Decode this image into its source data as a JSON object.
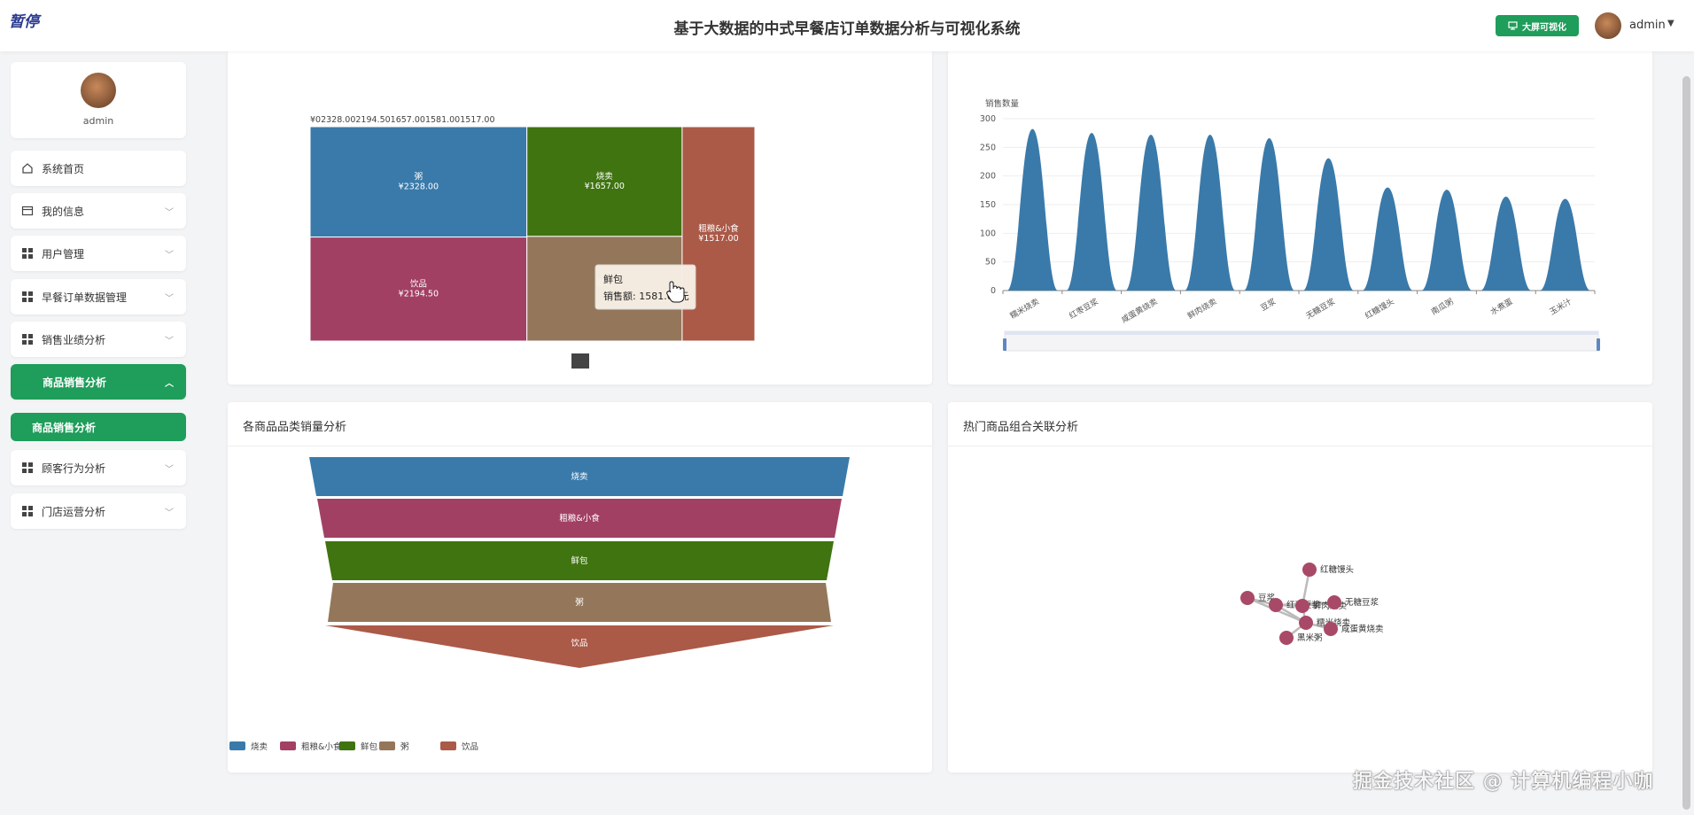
{
  "header": {
    "logo": "暂停",
    "title": "基于大数据的中式早餐店订单数据分析与可视化系统",
    "screen_button": "大屏可视化",
    "username": "admin"
  },
  "sidebar": {
    "profile_name": "admin",
    "items": [
      {
        "label": "系统首页"
      },
      {
        "label": "我的信息"
      },
      {
        "label": "用户管理"
      },
      {
        "label": "早餐订单数据管理"
      },
      {
        "label": "销售业绩分析"
      },
      {
        "label": "商品销售分析"
      },
      {
        "label": "顾客行为分析"
      },
      {
        "label": "门店运营分析"
      }
    ],
    "sub_item": "商品销售分析"
  },
  "cards": {
    "funnel_title": "各商品品类销量分析",
    "graph_title": "热门商品组合关联分析"
  },
  "colors": {
    "green": "#1f9d5a",
    "blue": "#3a7aaa",
    "rose": "#a24064",
    "olive": "#3f7410",
    "brown": "#94775a",
    "brick": "#ab5a48"
  },
  "treemap": {
    "top_label": "¥02328.002194.501657.001581.001517.00",
    "tooltip_name": "鲜包",
    "tooltip_value": "销售额: 1581.00元"
  },
  "chart_data": [
    {
      "type": "treemap",
      "items": [
        {
          "name": "粥",
          "value": 2328.0,
          "label": "¥2328.00"
        },
        {
          "name": "饮品",
          "value": 2194.5,
          "label": "¥2194.50"
        },
        {
          "name": "烧卖",
          "value": 1657.0,
          "label": "¥1657.00"
        },
        {
          "name": "鲜包",
          "value": 1581.0,
          "label": ""
        },
        {
          "name": "粗粮&小食",
          "value": 1517.0,
          "label": "¥1517.00"
        }
      ]
    },
    {
      "type": "area",
      "ylabel": "销售数量",
      "ylim": [
        0,
        300
      ],
      "yticks": [
        0,
        50,
        100,
        150,
        200,
        250,
        300
      ],
      "categories": [
        "糯米烧卖",
        "红枣豆浆",
        "咸蛋黄烧卖",
        "鲜肉烧卖",
        "豆浆",
        "无糖豆浆",
        "红糖馒头",
        "南瓜粥",
        "水煮蛋",
        "玉米汁"
      ],
      "values": [
        282,
        275,
        272,
        272,
        266,
        231,
        180,
        176,
        164,
        160
      ]
    },
    {
      "type": "funnel",
      "categories": [
        "烧卖",
        "粗粮&小食",
        "鲜包",
        "粥",
        "饮品"
      ],
      "legend": [
        "烧卖",
        "粗粮&小食",
        "鲜包",
        "粥",
        "饮品"
      ]
    },
    {
      "type": "graph",
      "nodes": [
        "红糖馒头",
        "豆浆",
        "红枣豆浆",
        "鲜肉烧卖",
        "无糖豆浆",
        "糯米烧卖",
        "黑米粥",
        "咸蛋黄烧卖"
      ]
    }
  ]
}
